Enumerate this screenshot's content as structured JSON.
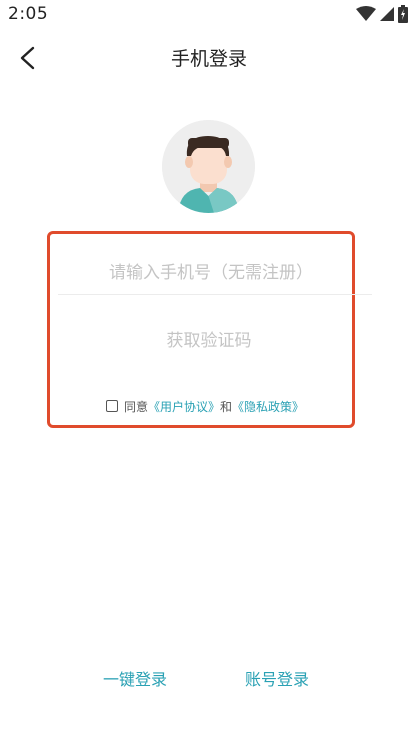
{
  "status_bar": {
    "time": "2:05",
    "icons": [
      "wifi-icon",
      "cellular-icon",
      "battery-icon"
    ]
  },
  "header": {
    "title": "手机登录",
    "back_icon": "back-arrow-icon"
  },
  "avatar": {
    "icon": "user-avatar-icon"
  },
  "form": {
    "phone_placeholder": "请输入手机号（无需注册）",
    "phone_value": "",
    "get_code_label": "获取验证码"
  },
  "agreement": {
    "checked": false,
    "prefix": "同意",
    "user_agreement": "《用户协议》",
    "conjunction": "和",
    "privacy_policy": "《隐私政策》"
  },
  "bottom_options": {
    "one_click_login": "一键登录",
    "account_login": "账号登录"
  },
  "colors": {
    "accent": "#2aa1b4",
    "highlight_border": "#e04b2c",
    "placeholder": "#c4c4c4"
  }
}
